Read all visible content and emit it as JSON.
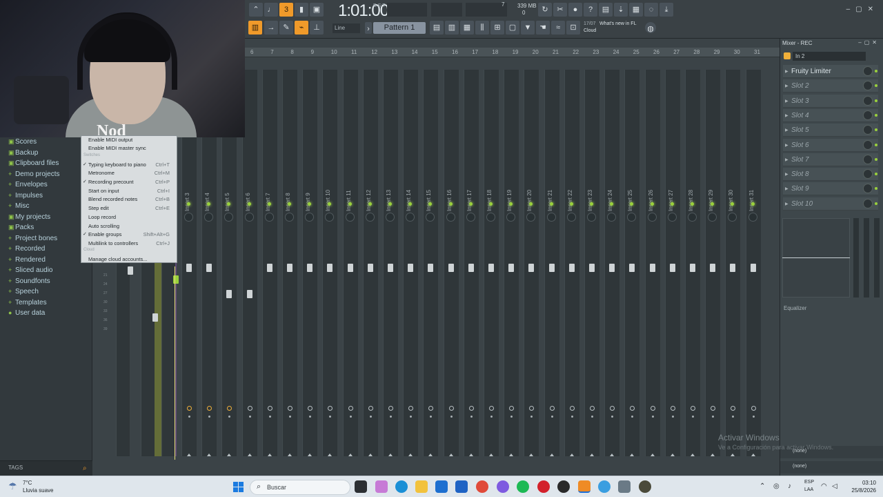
{
  "toolbar": {
    "time": "1:01:00",
    "time_sub": "B:S:T",
    "cpu_value": "7",
    "memory": "339 MB",
    "memory_sub": "0",
    "pattern": "Pattern 1",
    "snap": "Line",
    "hint_counter": "17/07",
    "hint_text": "What's new in FL",
    "hint_cloud": "Cloud",
    "accent_color": "#f09a2a"
  },
  "browser": {
    "items": [
      {
        "icon": "folder-icon",
        "label": "Scores"
      },
      {
        "icon": "folder-icon",
        "label": "Backup"
      },
      {
        "icon": "folder-icon",
        "label": "Clipboard files"
      },
      {
        "icon": "plus-icon",
        "label": "Demo projects"
      },
      {
        "icon": "plus-icon",
        "label": "Envelopes"
      },
      {
        "icon": "plus-icon",
        "label": "Impulses"
      },
      {
        "icon": "plus-icon",
        "label": "Misc"
      },
      {
        "icon": "folder-icon",
        "label": "My projects"
      },
      {
        "icon": "folder-icon",
        "label": "Packs"
      },
      {
        "icon": "plus-icon",
        "label": "Project bones"
      },
      {
        "icon": "plus-icon",
        "label": "Recorded"
      },
      {
        "icon": "plus-icon",
        "label": "Rendered"
      },
      {
        "icon": "plus-icon",
        "label": "Sliced audio"
      },
      {
        "icon": "plus-icon",
        "label": "Soundfonts"
      },
      {
        "icon": "plus-icon",
        "label": "Speech"
      },
      {
        "icon": "plus-icon",
        "label": "Templates"
      },
      {
        "icon": "user-icon",
        "label": "User data"
      }
    ],
    "tags_label": "TAGS"
  },
  "context_menu": {
    "items": [
      {
        "label": "Enable MIDI output",
        "shortcut": "",
        "checked": false
      },
      {
        "label": "Enable MIDI master sync",
        "shortcut": "",
        "checked": false
      },
      {
        "label": "Typing keyboard to piano",
        "shortcut": "Ctrl+T",
        "checked": true
      },
      {
        "label": "Metronome",
        "shortcut": "Ctrl+M",
        "checked": false
      },
      {
        "label": "Recording precount",
        "shortcut": "Ctrl+P",
        "checked": true
      },
      {
        "label": "Start on input",
        "shortcut": "Ctrl+I",
        "checked": false
      },
      {
        "label": "Blend recorded notes",
        "shortcut": "Ctrl+B",
        "checked": false
      },
      {
        "label": "Step edit",
        "shortcut": "Ctrl+E",
        "checked": false
      },
      {
        "label": "Loop record",
        "shortcut": "",
        "checked": false
      },
      {
        "label": "Auto scrolling",
        "shortcut": "",
        "checked": false
      },
      {
        "label": "Enable groups",
        "shortcut": "Shift+Alt+G",
        "checked": true
      },
      {
        "label": "Multilink to controllers",
        "shortcut": "Ctrl+J",
        "checked": false
      },
      {
        "label": "Manage cloud accounts...",
        "shortcut": "",
        "checked": false
      }
    ],
    "section_switches": "Switches",
    "section_cloud": "Cloud"
  },
  "mixer": {
    "ruler": [
      "6",
      "7",
      "8",
      "9",
      "10",
      "11",
      "12",
      "13",
      "14",
      "15",
      "16",
      "17",
      "18",
      "19",
      "20",
      "21",
      "22",
      "23",
      "24",
      "25",
      "26",
      "27",
      "28",
      "29",
      "30",
      "31"
    ],
    "inserts": [
      "Insert 3",
      "Insert 4",
      "Insert 5",
      "Insert 6",
      "Insert 7",
      "Insert 8",
      "Insert 9",
      "Insert 10",
      "Insert 11",
      "Insert 12",
      "Insert 13",
      "Insert 14",
      "Insert 15",
      "Insert 16",
      "Insert 17",
      "Insert 18",
      "Insert 19",
      "Insert 20",
      "Insert 21",
      "Insert 22",
      "Insert 23",
      "Insert 24",
      "Insert 25",
      "Insert 26",
      "Insert 27",
      "Insert 28",
      "Insert 29",
      "Insert 30",
      "Insert 31"
    ],
    "db_marks": [
      "21",
      "24",
      "27",
      "30",
      "33",
      "36",
      "39"
    ]
  },
  "mixer_panel": {
    "title": "Mixer - REC",
    "input": "In 2",
    "slots": [
      "Fruity Limiter",
      "Slot 2",
      "Slot 3",
      "Slot 4",
      "Slot 5",
      "Slot 6",
      "Slot 7",
      "Slot 8",
      "Slot 9",
      "Slot 10"
    ],
    "equalizer": "Equalizer",
    "send1": "(none)",
    "send2": "(none)"
  },
  "watermark": {
    "line1": "Activar Windows",
    "line2": "Ve a Configuración para activar Windows."
  },
  "taskbar": {
    "temperature": "7°C",
    "weather": "Lluvia suave",
    "search": "Buscar",
    "lang1": "ESP",
    "lang2": "LAA",
    "time": "03:10",
    "date": "25/8/2026"
  },
  "webcam": {
    "shirt_text": "Nod"
  }
}
